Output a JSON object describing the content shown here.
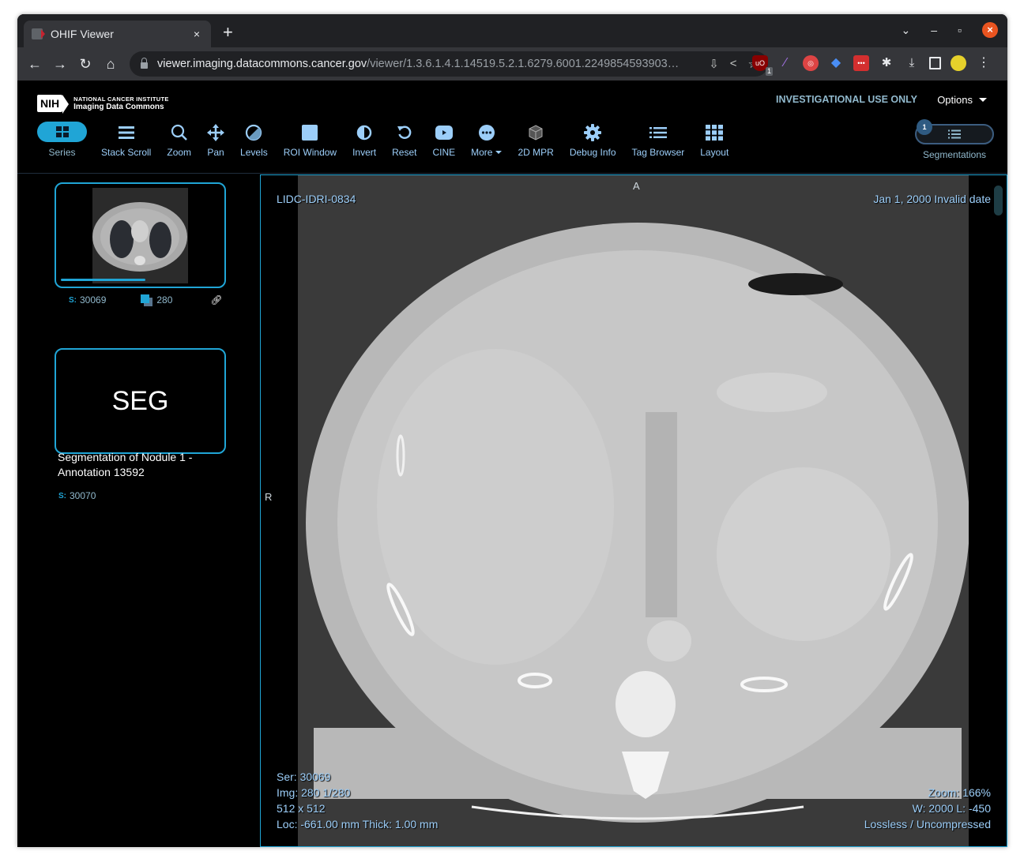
{
  "browser": {
    "tab_title": "OHIF Viewer",
    "tab_close": "×",
    "new_tab": "+",
    "url_host": "viewer.imaging.datacommons.cancer.gov",
    "url_path": "/viewer/1.3.6.1.4.1.14519.5.2.1.6279.6001.2249854593903…",
    "extension_badge": "1",
    "ext_icon_label": "uO"
  },
  "header": {
    "logo_mark": "NIH",
    "logo_sub": "NATIONAL CANCER INSTITUTE",
    "logo_main": "Imaging Data Commons",
    "investigational": "INVESTIGATIONAL USE ONLY",
    "options_label": "Options"
  },
  "toolbar": {
    "series_label": "Series",
    "tools": [
      {
        "label": "Stack Scroll",
        "icon": "bars-icon"
      },
      {
        "label": "Zoom",
        "icon": "magnifier-icon"
      },
      {
        "label": "Pan",
        "icon": "arrows-move-icon"
      },
      {
        "label": "Levels",
        "icon": "contrast-circle-icon"
      },
      {
        "label": "ROI Window",
        "icon": "square-icon"
      },
      {
        "label": "Invert",
        "icon": "half-circle-icon"
      },
      {
        "label": "Reset",
        "icon": "reset-icon"
      },
      {
        "label": "CINE",
        "icon": "play-icon"
      },
      {
        "label": "More",
        "icon": "ellipsis-circle-icon"
      },
      {
        "label": "2D MPR",
        "icon": "cube-icon"
      },
      {
        "label": "Debug Info",
        "icon": "gear-icon"
      },
      {
        "label": "Tag Browser",
        "icon": "list-icon"
      },
      {
        "label": "Layout",
        "icon": "grid-icon"
      }
    ],
    "segmentations_label": "Segmentations",
    "segmentations_count": "1"
  },
  "sidebar": {
    "series": [
      {
        "s_key": "S:",
        "series_number": "30069",
        "instances": "280"
      },
      {
        "thumb_text": "SEG",
        "description": "Segmentation of Nodule 1 - Annotation 13592",
        "s_key": "S:",
        "series_number": "30070"
      }
    ],
    "series_progress_fraction": 0.52
  },
  "viewport": {
    "top_left": "LIDC-IDRI-0834",
    "top_right": "Jan 1, 2000 Invalid date",
    "orientation_top": "A",
    "orientation_left": "R",
    "bottom_left": [
      "Ser: 30069",
      "Img: 280 1/280",
      "512 x 512",
      "Loc: -661.00 mm Thick: 1.00 mm"
    ],
    "bottom_right": [
      "Zoom: 166%",
      "W: 2000 L: -450",
      "Lossless / Uncompressed"
    ]
  }
}
